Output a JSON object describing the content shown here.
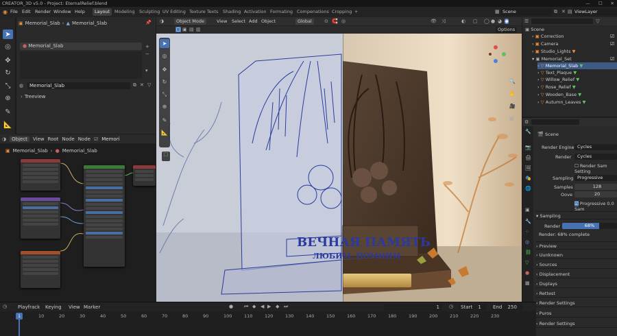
{
  "window": {
    "title": "CREATOR_3D v5.0 - Project: EternalRelief.blend"
  },
  "menu": [
    "File",
    "Edit",
    "Render",
    "Window",
    "Help"
  ],
  "workspaces": [
    "Layout",
    "Modeling",
    "Sculpting",
    "UV Editing",
    "Texture Texts",
    "Shading",
    "Activation",
    "Formating",
    "Compenations",
    "Cropping"
  ],
  "topright": {
    "scene": "Scene",
    "viewlayer": "ViewLayer"
  },
  "left_panel": {
    "breadcrumb_obj": "Memorial_Slab",
    "breadcrumb_mesh": "Memorial_Slab",
    "list_item": "Memorial_Slab",
    "name_field": "Memorial_Slab",
    "tree_label": "Treeview"
  },
  "node_editor": {
    "header": {
      "object": "Object",
      "menu": [
        "View",
        "Root",
        "Node",
        "Node"
      ],
      "memo": "Memori"
    },
    "crumb_a": "Memorial_Slab",
    "crumb_b": "Memorial_Slab"
  },
  "viewport": {
    "mode": "Object Mode",
    "menu": [
      "View",
      "Select",
      "Add",
      "Object"
    ],
    "transform": "Global",
    "options": "Options",
    "plaque": {
      "line1": "ВЕЧНАЯ ПАМЯТЬ",
      "line2": "ЛЮБИМ, ПОМНИМ"
    }
  },
  "outliner": {
    "root": "Scene",
    "items": [
      "Correction",
      "Camera",
      "Studio_Lights",
      "Memorial_Set",
      "Memorial_Slab",
      "Text_Plaque",
      "Willow_Relief",
      "Rose_Relief",
      "Wooden_Base",
      "Autumn_Leaves"
    ]
  },
  "properties": {
    "scene": "Scene",
    "render_engine_label": "Render Engine",
    "render_engine": "Cycles",
    "render_label": "Render",
    "render_value": "Cycles",
    "render_sam": "Render Sam Setting",
    "sampling_label": "Sampling",
    "sampling_value": "Progressive",
    "samples_label": "Samples",
    "samples_value": "128",
    "oove_label": "Oove",
    "oove_value": "20",
    "progressive_check": "Progressive 0.0 Sam",
    "sampling_section": "Sampling",
    "render_bar_label": "Render",
    "render_pct": "68%",
    "render_complete": "Render: 68% complete",
    "render_progress": 0.68,
    "sections": [
      "Preview",
      "Uunknown",
      "Sources",
      "Displacement",
      "Duplays",
      "Rettest",
      "Render Settings",
      "Puros",
      "Render Settings"
    ]
  },
  "timeline": {
    "menu": [
      "Playfrack",
      "Keying",
      "View",
      "Marker"
    ],
    "frame": "1",
    "start_label": "Start",
    "start": "1",
    "end_label": "End",
    "end": "250",
    "ticks": [
      "1",
      "10",
      "20",
      "30",
      "40",
      "50",
      "60",
      "70",
      "80",
      "90",
      "100",
      "110",
      "120",
      "130",
      "140",
      "150",
      "160",
      "170",
      "180",
      "190",
      "200",
      "210",
      "220",
      "230"
    ]
  }
}
